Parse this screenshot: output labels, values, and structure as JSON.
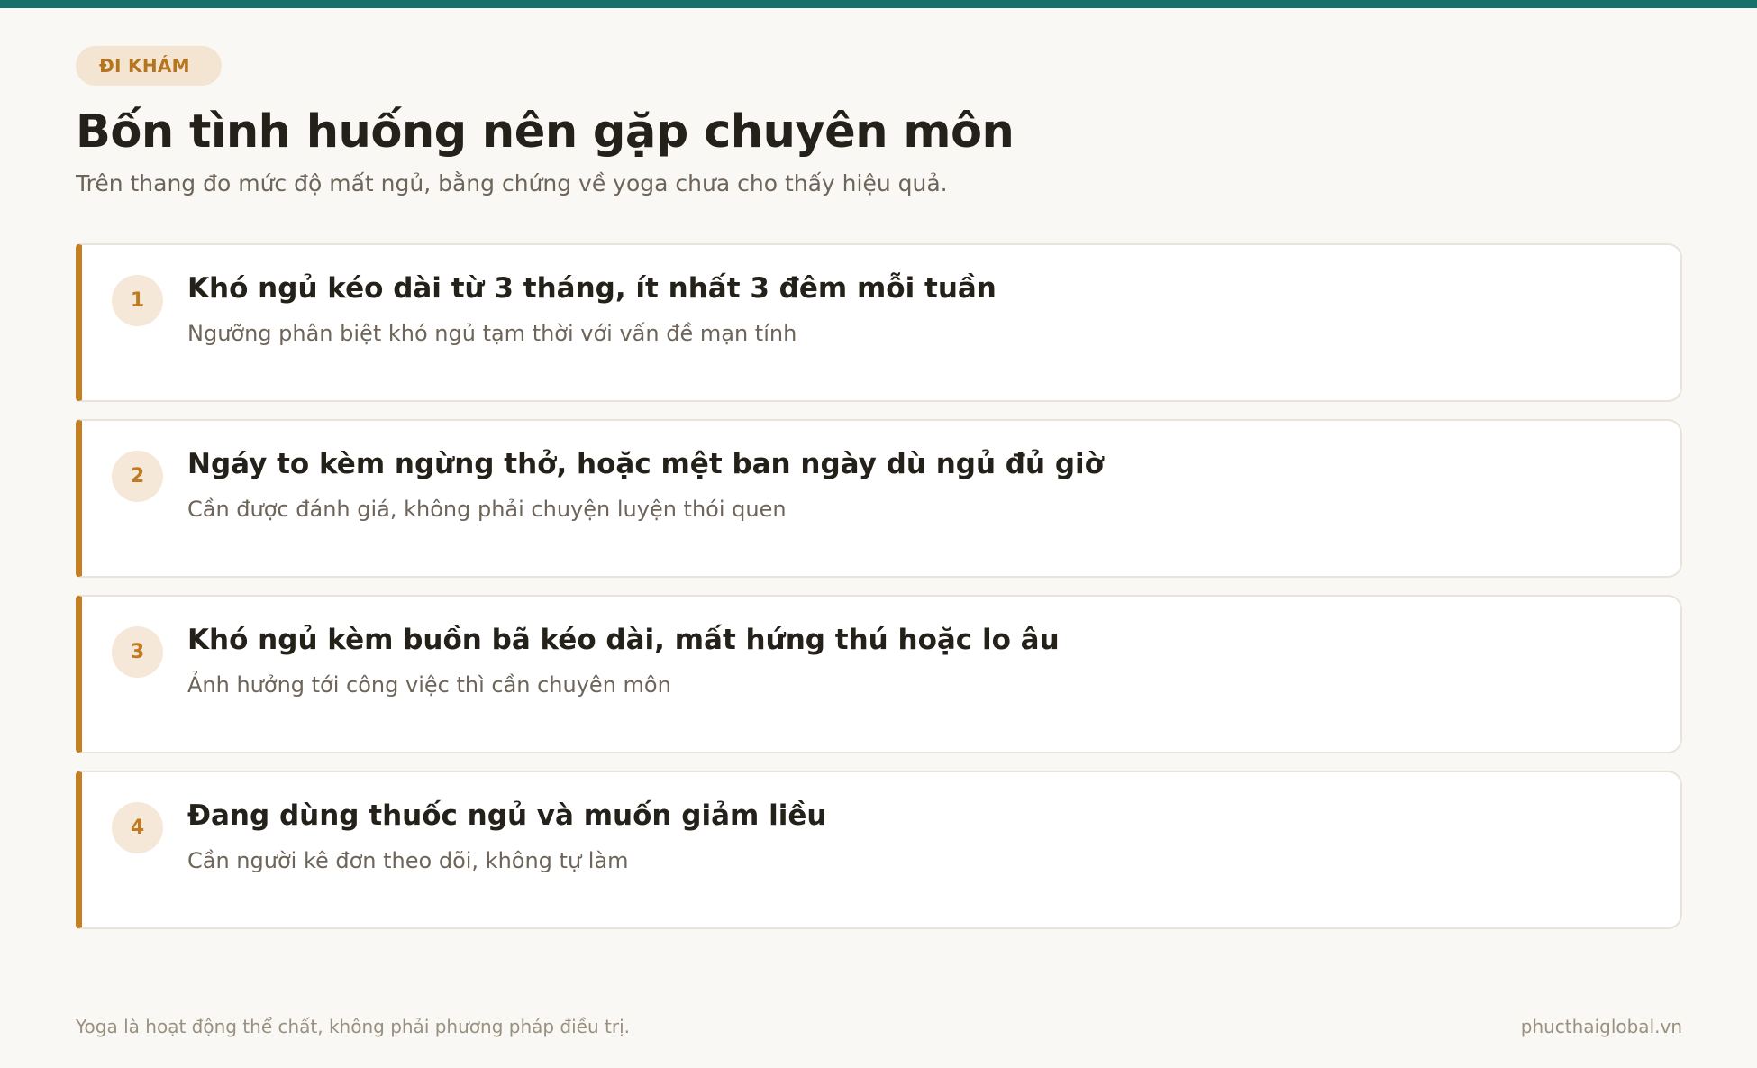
{
  "header": {
    "tag": "ĐI KHÁM",
    "title": "Bốn tình huống nên gặp chuyên môn",
    "subtitle": "Trên thang đo mức độ mất ngủ, bằng chứng về yoga chưa cho thấy hiệu quả."
  },
  "items": [
    {
      "number": "1",
      "title": "Khó ngủ kéo dài từ 3 tháng, ít nhất 3 đêm mỗi tuần",
      "description": "Ngưỡng phân biệt khó ngủ tạm thời với vấn đề mạn tính"
    },
    {
      "number": "2",
      "title": "Ngáy to kèm ngừng thở, hoặc mệt ban ngày dù ngủ đủ giờ",
      "description": "Cần được đánh giá, không phải chuyện luyện thói quen"
    },
    {
      "number": "3",
      "title": "Khó ngủ kèm buồn bã kéo dài, mất hứng thú hoặc lo âu",
      "description": "Ảnh hưởng tới công việc thì cần chuyên môn"
    },
    {
      "number": "4",
      "title": "Đang dùng thuốc ngủ và muốn giảm liều",
      "description": "Cần người kê đơn theo dõi, không tự làm"
    }
  ],
  "footer": {
    "note": "Yoga là hoạt động thể chất, không phải phương pháp điều trị.",
    "site": "phucthaiglobal.vn"
  },
  "colors": {
    "top_bar": "#177069",
    "accent": "#c47f23",
    "background": "#faf8f4"
  }
}
